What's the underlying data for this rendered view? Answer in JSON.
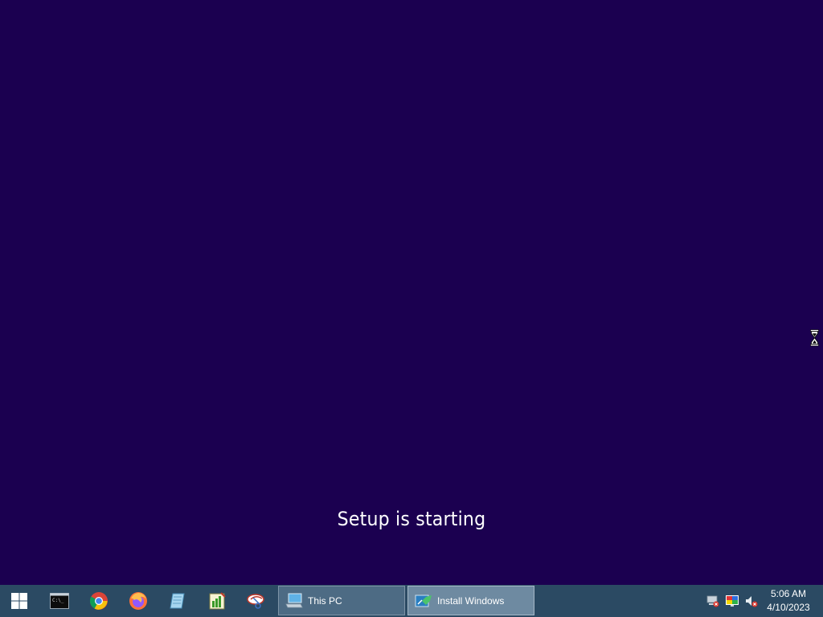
{
  "setup": {
    "status_text": "Setup is starting"
  },
  "taskbar": {
    "start_icon": "windows-logo-icon",
    "pinned": [
      {
        "name": "cmd-icon"
      },
      {
        "name": "chrome-icon"
      },
      {
        "name": "firefox-icon"
      },
      {
        "name": "notepad-icon"
      },
      {
        "name": "chart-tool-icon"
      },
      {
        "name": "snipping-tool-icon"
      }
    ],
    "windows": [
      {
        "label": "This PC",
        "icon": "computer-icon"
      },
      {
        "label": "Install Windows",
        "icon": "setup-icon"
      }
    ],
    "tray": [
      {
        "name": "network-disconnected-icon"
      },
      {
        "name": "display-color-icon"
      },
      {
        "name": "volume-muted-icon"
      }
    ],
    "clock": {
      "time": "5:06 AM",
      "date": "4/10/2023"
    }
  },
  "colors": {
    "desktop_background": "#1b0050",
    "taskbar_background": "#2b4a63",
    "text": "#ffffff"
  },
  "cursor": {
    "icon": "hourglass-busy-cursor-icon"
  }
}
